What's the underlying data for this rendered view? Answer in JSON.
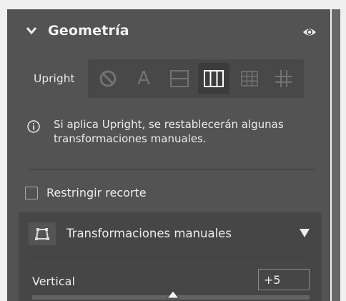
{
  "section": {
    "title": "Geometría",
    "visibility_icon": "eye-icon",
    "collapse_icon": "chevron-down-icon"
  },
  "upright": {
    "label": "Upright",
    "modes": [
      {
        "name": "off",
        "icon": "no-symbol-icon",
        "active": false
      },
      {
        "name": "auto",
        "icon": "letter-a-icon",
        "glyph": "A",
        "active": false
      },
      {
        "name": "level",
        "icon": "level-icon",
        "active": false
      },
      {
        "name": "vertical",
        "icon": "vertical-columns-icon",
        "active": true
      },
      {
        "name": "full",
        "icon": "grid-icon",
        "active": false
      },
      {
        "name": "guided",
        "icon": "guided-crosshair-icon",
        "active": false
      }
    ]
  },
  "info": {
    "icon": "info-icon",
    "text": "Si aplica Upright, se restablecerán algunas transformaciones manuales."
  },
  "constrain_crop": {
    "label": "Restringir recorte",
    "checked": false
  },
  "manual_transforms": {
    "title": "Transformaciones manuales",
    "icon": "transform-icon",
    "toggle_icon": "triangle-down-icon",
    "vertical": {
      "label": "Vertical",
      "value": "+5"
    }
  },
  "colors": {
    "panel_bg": "#535353",
    "subpanel_bg": "#464646",
    "text": "#ececec",
    "icon_dim": "#727272",
    "active_bg": "#3c3c3c"
  }
}
